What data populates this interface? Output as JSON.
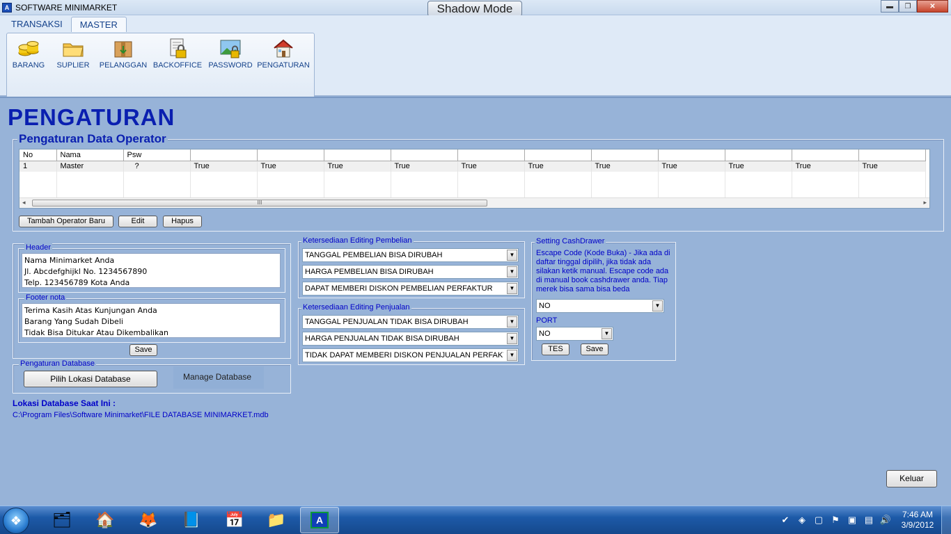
{
  "window": {
    "title": "SOFTWARE MINIMARKET",
    "app_icon": "A",
    "shadow_mode": "Shadow Mode",
    "min_symbol": "▬",
    "max_symbol": "❐",
    "close_symbol": "✕"
  },
  "ribbon": {
    "tabs": [
      {
        "label": "TRANSAKSI"
      },
      {
        "label": "MASTER"
      }
    ],
    "buttons": [
      {
        "label": "BARANG",
        "icon": "coins-icon"
      },
      {
        "label": "SUPLIER",
        "icon": "folder-icon"
      },
      {
        "label": "PELANGGAN",
        "icon": "box-icon"
      },
      {
        "label": "BACKOFFICE",
        "icon": "document-lock-icon"
      },
      {
        "label": "PASSWORD",
        "icon": "landscape-lock-icon"
      },
      {
        "label": "PENGATURAN",
        "icon": "house-icon"
      }
    ]
  },
  "page": {
    "title": "PENGATURAN"
  },
  "operator": {
    "legend": "Pengaturan Data Operator",
    "columns": [
      "No",
      "Nama",
      "Psw",
      "",
      "",
      "",
      "",
      "",
      "",
      "",
      "",
      "",
      "",
      ""
    ],
    "rows": [
      [
        "1",
        "Master",
        "?",
        "True",
        "True",
        "True",
        "True",
        "True",
        "True",
        "True",
        "True",
        "True",
        "True",
        "True"
      ]
    ],
    "scroll_grip": "III",
    "scroll_left": "◂",
    "scroll_right": "▸",
    "add_label": "Tambah Operator Baru",
    "edit_label": "Edit",
    "delete_label": "Hapus"
  },
  "header": {
    "legend": "Header",
    "lines": [
      "Nama Minimarket Anda",
      "Jl. Abcdefghijkl No. 1234567890",
      "Telp. 123456789 Kota Anda"
    ]
  },
  "footer": {
    "legend": "Footer nota",
    "lines": [
      "Terima Kasih Atas Kunjungan Anda",
      "Barang Yang Sudah Dibeli",
      "Tidak Bisa Ditukar Atau Dikembalikan"
    ],
    "save_label": "Save"
  },
  "database": {
    "legend": "Pengaturan Database",
    "choose_label": "Pilih Lokasi Database",
    "manage_label": "Manage Database",
    "current_label": "Lokasi Database Saat Ini :",
    "current_path": "C:\\Program Files\\Software Minimarket\\FILE DATABASE MINIMARKET.mdb"
  },
  "purchase_edit": {
    "legend": "Ketersediaan Editing Pembelian",
    "options": [
      "TANGGAL PEMBELIAN BISA DIRUBAH",
      "HARGA PEMBELIAN BISA DIRUBAH",
      "DAPAT MEMBERI DISKON PEMBELIAN PERFAKTUR"
    ]
  },
  "sales_edit": {
    "legend": "Ketersediaan Editing Penjualan",
    "options": [
      "TANGGAL PENJUALAN TIDAK BISA DIRUBAH",
      "HARGA PENJUALAN TIDAK BISA DIRUBAH",
      "TIDAK DAPAT MEMBERI DISKON PENJUALAN PERFAKTUR"
    ]
  },
  "cashdrawer": {
    "legend": "Setting CashDrawer",
    "description": "Escape Code (Kode Buka) - Jika ada di daftar tinggal dipilih, jika tidak ada silakan ketik manual. Escape code ada di manual book cashdrawer anda. Tiap merek bisa sama bisa beda",
    "escape_value": "NO",
    "port_label": "PORT",
    "port_value": "NO",
    "test_label": "TES",
    "save_label": "Save"
  },
  "exit_label": "Keluar",
  "dropdown_arrow": "▼",
  "taskbar": {
    "start_icon": "windows-start-icon",
    "start_glyph": "❖",
    "items": [
      {
        "icon": "ie-folder-icon",
        "glyph": "🗂"
      },
      {
        "icon": "house-lock-icon",
        "glyph": "🏠"
      },
      {
        "icon": "firefox-icon",
        "glyph": "🦊"
      },
      {
        "icon": "notebook-icon",
        "glyph": "📘"
      },
      {
        "icon": "calendar-icon",
        "glyph": "📅"
      },
      {
        "icon": "explorer-icon",
        "glyph": "📁"
      },
      {
        "icon": "app-minimarket-icon",
        "glyph": "A"
      }
    ],
    "tray_icons": [
      {
        "icon": "network-check-icon",
        "glyph": "✔"
      },
      {
        "icon": "bluetooth-icon",
        "glyph": "◈"
      },
      {
        "icon": "blank-icon",
        "glyph": "▢"
      },
      {
        "icon": "flag-icon",
        "glyph": "⚑"
      },
      {
        "icon": "device-icon",
        "glyph": "▣"
      },
      {
        "icon": "network-icon",
        "glyph": "▤"
      },
      {
        "icon": "volume-icon",
        "glyph": "🔊"
      }
    ],
    "time": "7:46 AM",
    "date": "3/9/2012"
  }
}
